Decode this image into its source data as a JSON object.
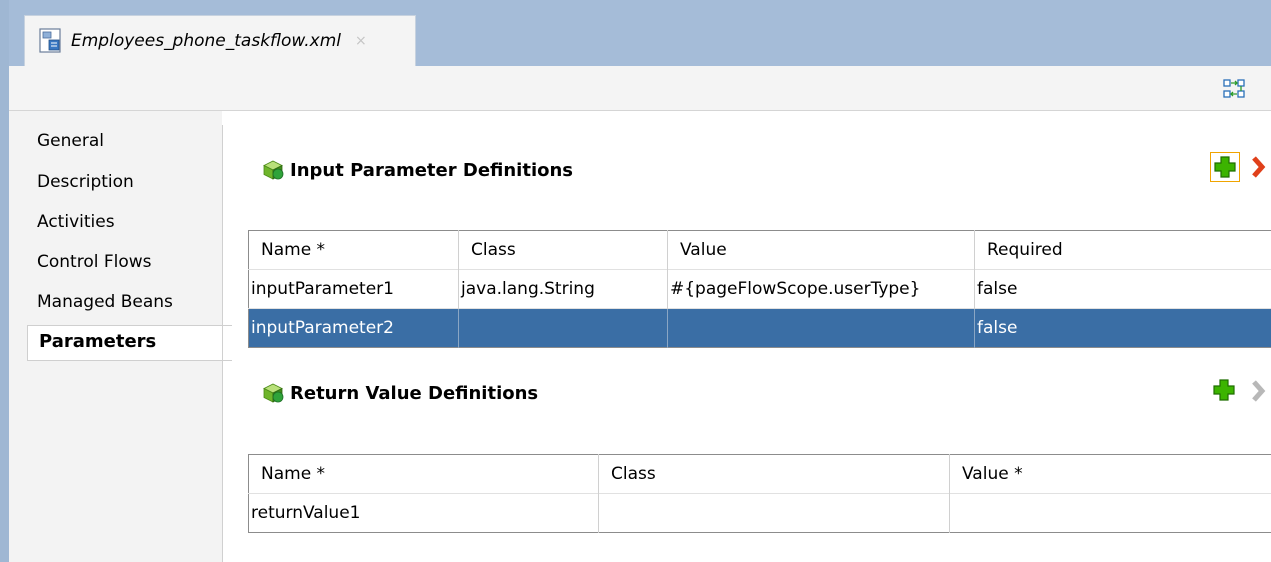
{
  "tab": {
    "title": "Employees_phone_taskflow.xml",
    "close": "×"
  },
  "sidebar": {
    "items": [
      {
        "label": "General"
      },
      {
        "label": "Description"
      },
      {
        "label": "Activities"
      },
      {
        "label": "Control Flows"
      },
      {
        "label": "Managed Beans"
      },
      {
        "label": "Parameters"
      }
    ]
  },
  "input_params": {
    "title": "Input Parameter Definitions",
    "columns": [
      "Name *",
      "Class",
      "Value",
      "Required"
    ],
    "rows": [
      [
        "inputParameter1",
        "java.lang.String",
        "#{pageFlowScope.userType}",
        "false"
      ],
      [
        "inputParameter2",
        "",
        "",
        "false"
      ]
    ]
  },
  "return_values": {
    "title": "Return Value Definitions",
    "columns": [
      "Name *",
      "Class",
      "Value *"
    ],
    "rows": [
      [
        "returnValue1",
        "",
        ""
      ]
    ]
  },
  "colors": {
    "tabstrip": "#a5bcd8",
    "selected_row": "#3a6ea5",
    "add_green": "#3cb400",
    "delete_red": "#e0401a"
  },
  "icons": [
    "taskflow-file-icon",
    "swap-layout-icon",
    "cube-icon",
    "add-icon",
    "delete-icon"
  ]
}
